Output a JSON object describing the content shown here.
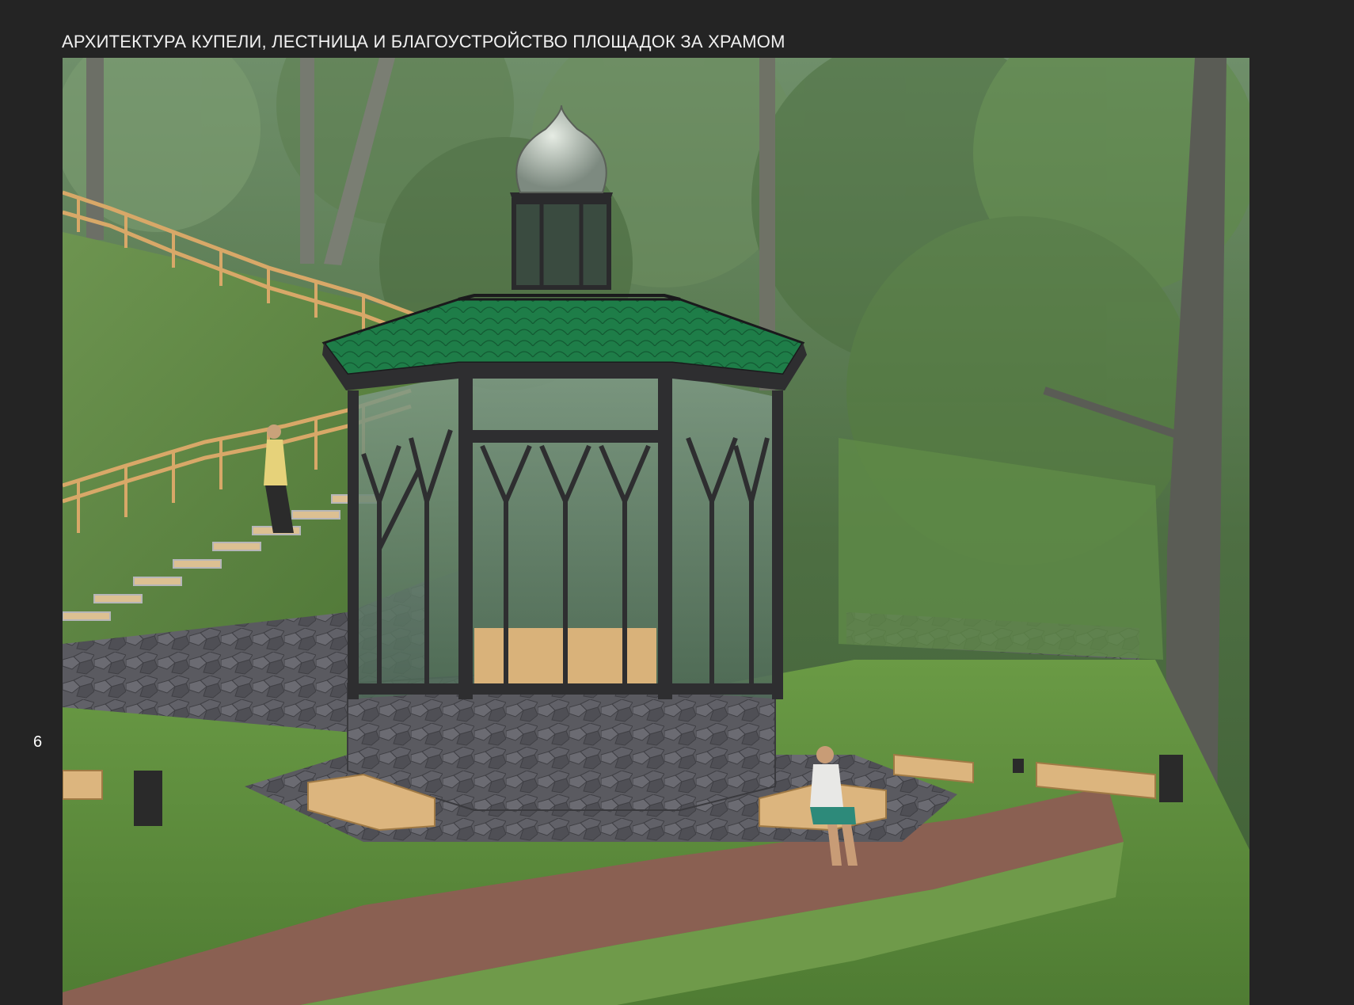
{
  "header": {
    "title": "АРХИТЕКТУРА КУПЕЛИ, ЛЕСТНИЦА И БЛАГОУСТРОЙСТВО ПЛОЩАДОК ЗА ХРАМОМ"
  },
  "footer": {
    "page_number": "6"
  },
  "colors": {
    "page_background": "#242424",
    "roof_green": "#1f7a4a",
    "frame_dark": "#2e2e30",
    "lawn": "#5b8a3e",
    "wood": "#d9b27a"
  },
  "icons": {
    "render": "chapel-render-image"
  }
}
